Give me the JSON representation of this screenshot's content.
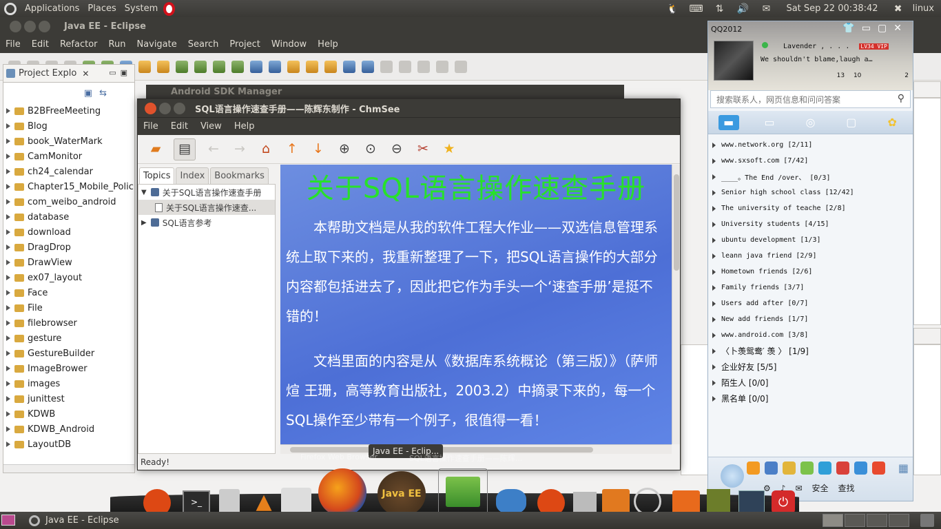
{
  "top_panel": {
    "menus": [
      "Applications",
      "Places",
      "System"
    ],
    "clock": "Sat Sep 22 00:38:42",
    "user": "linux"
  },
  "eclipse": {
    "title": "Java EE - Eclipse",
    "menus": [
      "File",
      "Edit",
      "Refactor",
      "Run",
      "Navigate",
      "Search",
      "Project",
      "Window",
      "Help"
    ],
    "project_explorer_tab": "Project Explo",
    "projects": [
      "B2BFreeMeeting",
      "Blog",
      "book_WaterMark",
      "CamMonitor",
      "ch24_calendar",
      "Chapter15_Mobile_Polic",
      "com_weibo_android",
      "database",
      "download",
      "DragDrop",
      "DrawView",
      "ex07_layout",
      "Face",
      "File",
      "filebrowser",
      "gesture",
      "GestureBuilder",
      "ImageBrower",
      "images",
      "junittest",
      "KDWB",
      "KDWB_Android",
      "LayoutDB"
    ],
    "sdk_manager_title": "Android SDK Manager"
  },
  "chmsee": {
    "title": "SQL语言操作速查手册——陈辉东制作 - ChmSee",
    "menus": [
      "File",
      "Edit",
      "View",
      "Help"
    ],
    "tabs": [
      "Topics",
      "Index",
      "Bookmarks"
    ],
    "tree": {
      "root": "关于SQL语言操作速查手册",
      "child": "关于SQL语言操作速查...",
      "second": "SQL语言参考"
    },
    "content": {
      "heading": "关于SQL语言操作速查手册",
      "para1": "本帮助文档是从我的软件工程大作业——双选信息管理系统上取下来的，我重新整理了一下，把SQL语言操作的大部分内容都包括进去了，因此把它作为手头一个‘速查手册’是挺不错的！",
      "para2": "文档里面的内容是从《数据库系统概论（第三版）》（萨师煊 王珊，高等教育出版社，2003.2）中摘录下来的，每一个SQL操作至少带有一个例子，很值得一看！"
    },
    "status": "Ready!"
  },
  "qq": {
    "app_name": "QQ2012",
    "nickname": "Lavender , . . .",
    "level_badge": "LV34 VIP",
    "signature": "We shouldn't blame,laugh a…",
    "stats": [
      "13",
      "10",
      "2"
    ],
    "search_placeholder": "搜索联系人，网页信息和问问答案",
    "groups": [
      "www.network.org  [2/11]",
      "www.sxsoft.com  [7/42]",
      "____。The End /over、  [0/3]",
      "Senior high school class  [12/42]",
      "The university of teache  [2/8]",
      "University students   [4/15]",
      "ubuntu development  [1/3]",
      "leann java  friend  [2/9]",
      "Hometown friends   [2/6]",
      "Family friends  [3/7]",
      "Users add after   [0/7]",
      "New add friends   [1/7]",
      "www.android.com   [3/8]",
      "〈卜羡鸳鸯′ 羡 〉 [1/9]",
      "企业好友 [5/5]",
      "陌生人  [0/0]",
      "黑名单  [0/0]"
    ],
    "footer": {
      "security": "安全",
      "find": "查找"
    }
  },
  "dock": {
    "tooltip": "Java EE - Eclip...",
    "ghost_labels": [
      "Firefox Web Browser",
      "SQL语言操作速查手册——陈辉..."
    ],
    "java_label": "Java EE"
  },
  "bottom_panel": {
    "task": "Java EE - Eclipse"
  }
}
